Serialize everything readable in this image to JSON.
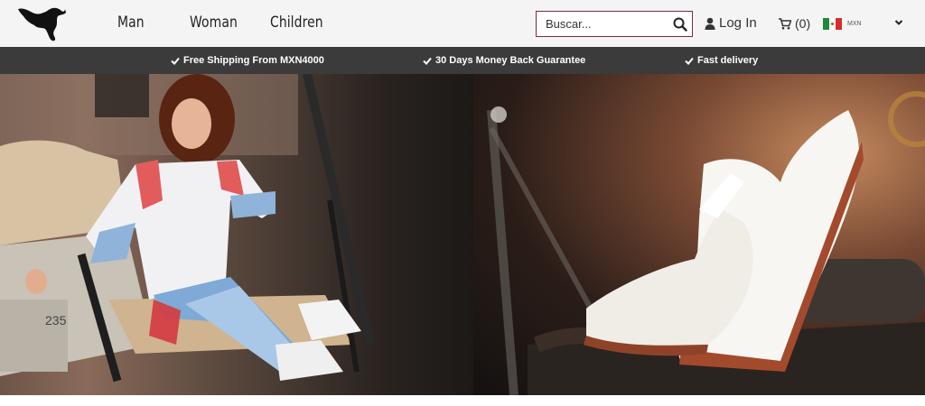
{
  "header": {
    "logo_icon": "puma-cat-logo-icon",
    "nav": [
      {
        "label": "Man"
      },
      {
        "label": "Woman"
      },
      {
        "label": "Children"
      }
    ],
    "search": {
      "placeholder": "Buscar...",
      "value": "",
      "icon": "search-icon"
    },
    "login": {
      "label": "Log In",
      "icon": "user-icon"
    },
    "cart": {
      "count_label": "(0)",
      "icon": "cart-icon"
    },
    "currency": {
      "label": "MXN",
      "flag": "mexico-flag-icon"
    }
  },
  "promo": {
    "items": [
      {
        "label": "Free Shipping From MXN4000"
      },
      {
        "label": "30 Days Money Back Guarantee"
      },
      {
        "label": "Fast delivery"
      }
    ]
  },
  "hero": {
    "left_image": "woman-in-tracksuit-sitting-on-golf-cart",
    "right_image": "white-sneakers-on-golf-cart",
    "cart_number": "235"
  },
  "colors": {
    "header_bg": "#f4f4f5",
    "promo_bg": "#3b3b3b",
    "search_border": "#7a2c3e"
  }
}
